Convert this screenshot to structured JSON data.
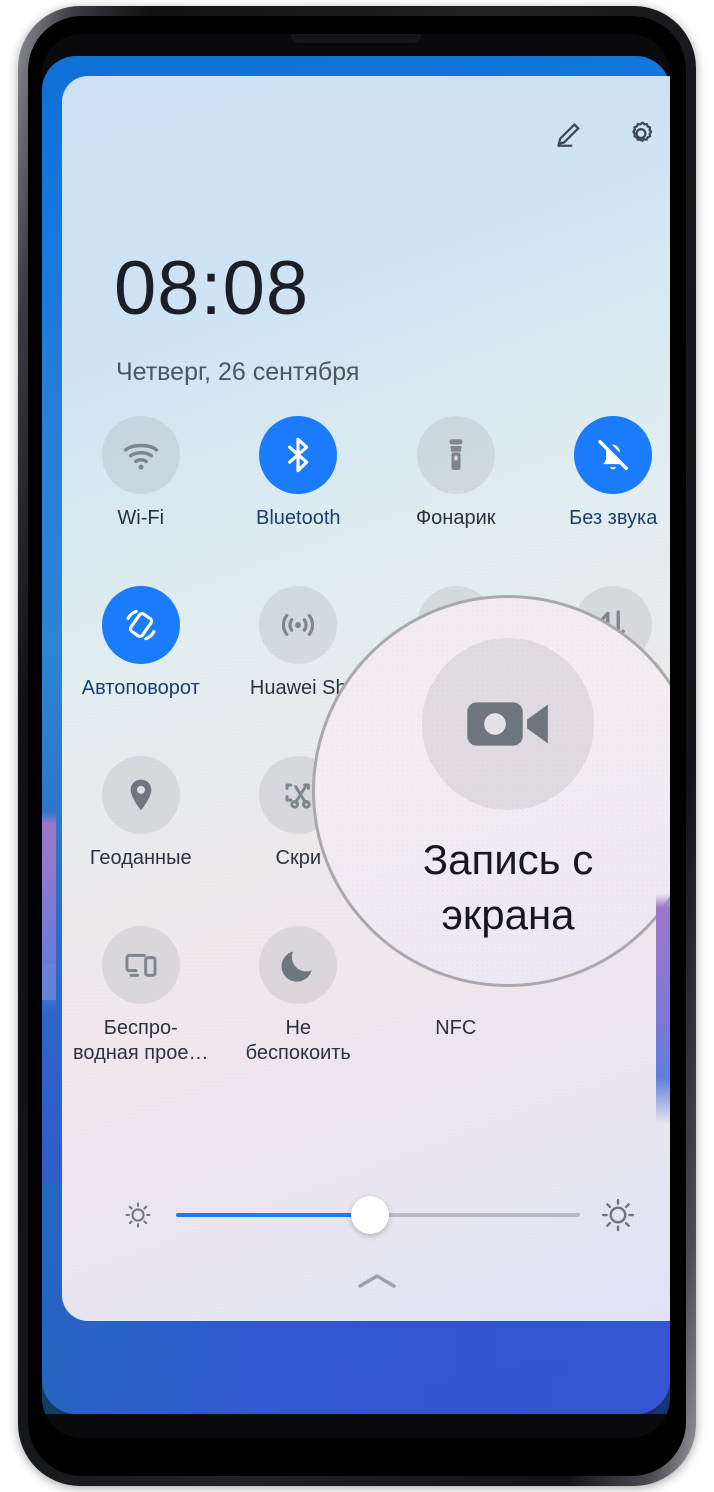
{
  "device": {
    "name": "huawei-phone"
  },
  "panel": {
    "title": "control-panel",
    "header": {
      "edit_icon": "pencil-edit-icon",
      "settings_icon": "gear-settings-icon"
    },
    "clock": "08:08",
    "date": "Четверг, 26 сентября"
  },
  "toggles": [
    [
      {
        "label": "Wi-Fi",
        "icon": "wifi-icon",
        "state": "off"
      },
      {
        "label": "Bluetooth",
        "icon": "bluetooth-icon",
        "state": "on"
      },
      {
        "label": "Фонарик",
        "icon": "flashlight-icon",
        "state": "off"
      },
      {
        "label": "Без звука",
        "icon": "bell-muted-icon",
        "state": "on"
      }
    ],
    [
      {
        "label": "Автоповорот",
        "icon": "auto-rotate-icon",
        "state": "on"
      },
      {
        "label": "Huawei Sh",
        "icon": "huawei-share-icon",
        "state": "off"
      },
      {
        "label": "",
        "icon": "screen-record-icon",
        "state": "off"
      },
      {
        "label": "",
        "icon": "mobile-data-icon",
        "state": "off"
      }
    ],
    [
      {
        "label": "Геоданные",
        "icon": "location-pin-icon",
        "state": "off"
      },
      {
        "label": "Скри",
        "icon": "screenshot-icon",
        "state": "off"
      },
      {
        "label": "",
        "icon": "blank-icon",
        "state": "off"
      },
      {
        "label": "",
        "icon": "blank-icon",
        "state": "off"
      }
    ],
    [
      {
        "label": "Беспро-\nводная прое…",
        "icon": "wireless-projection-icon",
        "state": "off"
      },
      {
        "label": "Не\nбеспокоить",
        "icon": "moon-icon",
        "state": "off"
      },
      {
        "label": "NFC",
        "icon": "nfc-icon",
        "state": "off"
      },
      {
        "label": "",
        "icon": "blank-icon",
        "state": "off"
      }
    ]
  ],
  "brightness": {
    "low_icon": "brightness-low-icon",
    "high_icon": "brightness-high-icon",
    "value_percent": 48,
    "collapse_icon": "chevron-up-icon"
  },
  "magnifier": {
    "icon": "screen-record-camera-icon",
    "label": "Запись с\nэкрана"
  },
  "colors": {
    "accent_blue": "#1a7bfb",
    "wallpaper_blue": "#2a7fd8",
    "panel_light": "#dfe3f6",
    "text_dark": "#1a1f27",
    "text_muted": "#4d5562"
  }
}
